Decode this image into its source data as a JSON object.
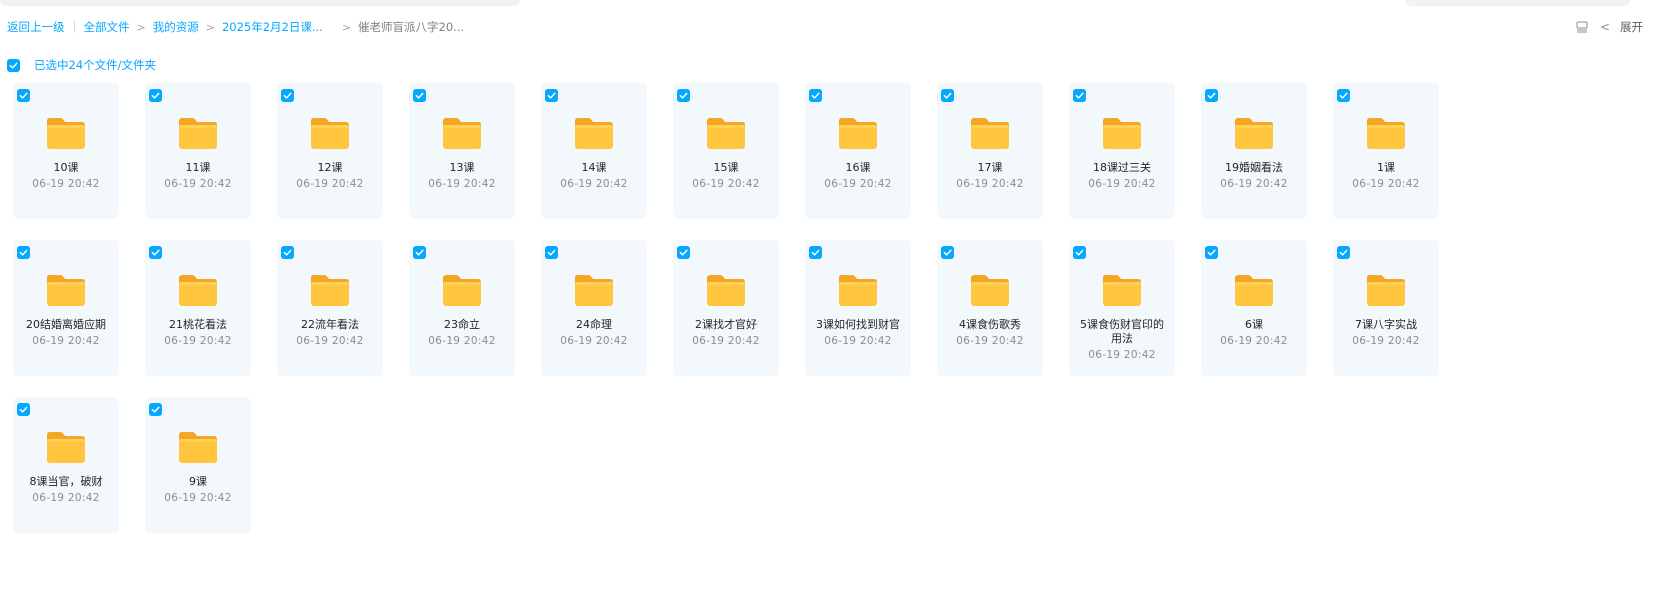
{
  "breadcrumb": {
    "back": "返回上一级",
    "items": [
      "全部文件",
      "我的资源",
      "2025年2月2日课...",
      "催老师盲派八字20..."
    ]
  },
  "toolbar": {
    "expand_label": "展开",
    "view_icon": "list-view-icon",
    "collapse_icon": "chevron-left-icon"
  },
  "selection": {
    "label": "已选中24个文件/文件夹",
    "checked": true
  },
  "colors": {
    "accent": "#06a7ff",
    "card_bg": "#f2f8fc",
    "folder": "#ffc53d"
  },
  "folders": [
    {
      "name": "10课",
      "time": "06-19 20:42"
    },
    {
      "name": "11课",
      "time": "06-19 20:42"
    },
    {
      "name": "12课",
      "time": "06-19 20:42"
    },
    {
      "name": "13课",
      "time": "06-19 20:42"
    },
    {
      "name": "14课",
      "time": "06-19 20:42"
    },
    {
      "name": "15课",
      "time": "06-19 20:42"
    },
    {
      "name": "16课",
      "time": "06-19 20:42"
    },
    {
      "name": "17课",
      "time": "06-19 20:42"
    },
    {
      "name": "18课过三关",
      "time": "06-19 20:42"
    },
    {
      "name": "19婚姻看法",
      "time": "06-19 20:42"
    },
    {
      "name": "1课",
      "time": "06-19 20:42"
    },
    {
      "name": "20结婚离婚应期",
      "time": "06-19 20:42"
    },
    {
      "name": "21桃花看法",
      "time": "06-19 20:42"
    },
    {
      "name": "22流年看法",
      "time": "06-19 20:42"
    },
    {
      "name": "23命立",
      "time": "06-19 20:42"
    },
    {
      "name": "24命理",
      "time": "06-19 20:42"
    },
    {
      "name": "2课找才官好",
      "time": "06-19 20:42"
    },
    {
      "name": "3课如何找到财官",
      "time": "06-19 20:42"
    },
    {
      "name": "4课食伤歌秀",
      "time": "06-19 20:42"
    },
    {
      "name": "5课食伤财官印的用法",
      "time": "06-19 20:42"
    },
    {
      "name": "6课",
      "time": "06-19 20:42"
    },
    {
      "name": "7课八字实战",
      "time": "06-19 20:42"
    },
    {
      "name": "8课当官，破财",
      "time": "06-19 20:42"
    },
    {
      "name": "9课",
      "time": "06-19 20:42"
    }
  ]
}
